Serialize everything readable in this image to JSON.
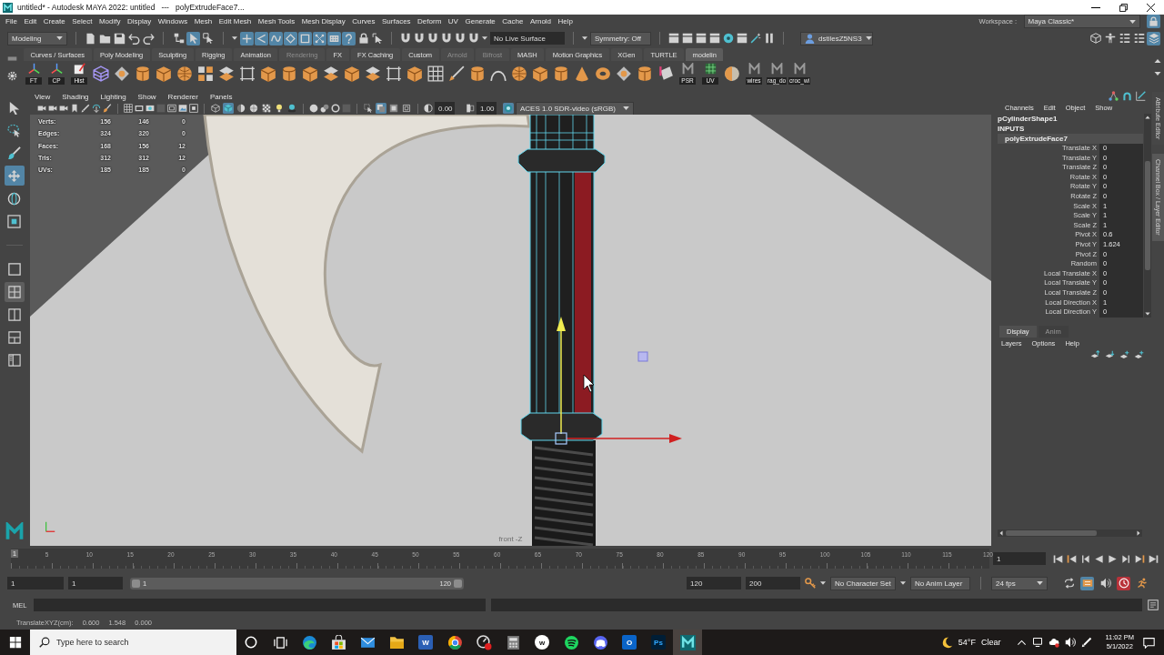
{
  "window": {
    "title": "untitled* - Autodesk MAYA 2022: untitled   ---   polyExtrudeFace7..."
  },
  "menu_bar": {
    "items": [
      "File",
      "Edit",
      "Create",
      "Select",
      "Modify",
      "Display",
      "Windows",
      "Mesh",
      "Edit Mesh",
      "Mesh Tools",
      "Mesh Display",
      "Curves",
      "Surfaces",
      "Deform",
      "UV",
      "Generate",
      "Cache",
      "Arnold",
      "Help"
    ],
    "workspace_label": "Workspace :",
    "workspace": "Maya Classic*",
    "workspace_lock": {
      "on": true
    }
  },
  "status_line": {
    "mode": "Modeling",
    "select_modes": [
      {
        "on": false
      },
      {
        "on": true
      },
      {
        "on": false
      }
    ],
    "masks": [
      {
        "on": true
      },
      {
        "on": true
      },
      {
        "on": true
      },
      {
        "on": true
      },
      {
        "on": true
      },
      {
        "on": true
      },
      {
        "on": true
      },
      {
        "on": true
      }
    ],
    "live_surface": "No Live Surface",
    "symmetry": "Symmetry: Off",
    "user": "dstilesZ5NS3",
    "panel_toggles": [
      {
        "on": false
      },
      {
        "on": false
      },
      {
        "on": false
      },
      {
        "on": false
      },
      {
        "on": true
      }
    ]
  },
  "shelf": {
    "tabs": [
      {
        "label": "Curves / Surfaces",
        "selected": false,
        "disabled": false
      },
      {
        "label": "Poly Modeling",
        "selected": false,
        "disabled": false
      },
      {
        "label": "Sculpting",
        "selected": false,
        "disabled": false
      },
      {
        "label": "Rigging",
        "selected": false,
        "disabled": false
      },
      {
        "label": "Animation",
        "selected": false,
        "disabled": false
      },
      {
        "label": "Rendering",
        "selected": false,
        "disabled": true
      },
      {
        "label": "FX",
        "selected": false,
        "disabled": false
      },
      {
        "label": "FX Caching",
        "selected": false,
        "disabled": false
      },
      {
        "label": "Custom",
        "selected": false,
        "disabled": false
      },
      {
        "label": "Arnold",
        "selected": false,
        "disabled": true
      },
      {
        "label": "Bifrost",
        "selected": false,
        "disabled": true
      },
      {
        "label": "MASH",
        "selected": false,
        "disabled": false
      },
      {
        "label": "Motion Graphics",
        "selected": false,
        "disabled": false
      },
      {
        "label": "XGen",
        "selected": false,
        "disabled": false
      },
      {
        "label": "TURTLE",
        "selected": false,
        "disabled": false
      },
      {
        "label": "modelin",
        "selected": true,
        "disabled": false
      }
    ],
    "history_buttons": [
      {
        "label": "FT"
      },
      {
        "label": "CP"
      },
      {
        "label": "Hist"
      }
    ],
    "tool_buttons": [
      {
        "label": "PSR"
      },
      {
        "label": "UV"
      }
    ],
    "script_buttons": [
      {
        "label": "wires"
      },
      {
        "label": "rag_do"
      },
      {
        "label": "croc_wi"
      }
    ]
  },
  "toolbox": {
    "tools": [
      {
        "selected": false
      },
      {
        "selected": false
      },
      {
        "selected": false
      },
      {
        "selected": true
      },
      {
        "selected": false
      },
      {
        "selected": false
      }
    ],
    "layouts": [
      {
        "selected": false
      },
      {
        "selected": true
      },
      {
        "selected": false
      },
      {
        "selected": false
      },
      {
        "selected": false
      }
    ]
  },
  "viewport_panel": {
    "menu": [
      "View",
      "Shading",
      "Lighting",
      "Show",
      "Renderer",
      "Panels"
    ],
    "shading_buttons": [
      {
        "on": false
      },
      {
        "on": true
      },
      {
        "on": false
      },
      {
        "on": false
      },
      {
        "on": false
      },
      {
        "on": false
      },
      {
        "on": false
      }
    ],
    "display_buttons": [
      {
        "on": false
      },
      {
        "on": true
      },
      {
        "on": false
      },
      {
        "on": false
      }
    ],
    "exposure": "0.00",
    "gamma": "1.00",
    "color_management": {
      "on": true
    },
    "color_space": "ACES 1.0 SDR-video (sRGB)",
    "hud": [
      {
        "label": "Verts:",
        "values": [
          "156",
          "146",
          "0"
        ]
      },
      {
        "label": "Edges:",
        "values": [
          "324",
          "320",
          "0"
        ]
      },
      {
        "label": "Faces:",
        "values": [
          "168",
          "156",
          "12"
        ]
      },
      {
        "label": "Tris:",
        "values": [
          "312",
          "312",
          "12"
        ]
      },
      {
        "label": "UVs:",
        "values": [
          "185",
          "185",
          "0"
        ]
      }
    ],
    "camera": "front -Z"
  },
  "channel_box": {
    "menu": [
      "Channels",
      "Edit",
      "Object",
      "Show"
    ],
    "object": "pCylinderShape1",
    "section": "INPUTS",
    "node": "polyExtrudeFace7",
    "attributes": [
      {
        "name": "Translate X",
        "value": "0"
      },
      {
        "name": "Translate Y",
        "value": "0"
      },
      {
        "name": "Translate Z",
        "value": "0"
      },
      {
        "name": "Rotate X",
        "value": "0"
      },
      {
        "name": "Rotate Y",
        "value": "0"
      },
      {
        "name": "Rotate Z",
        "value": "0"
      },
      {
        "name": "Scale X",
        "value": "1"
      },
      {
        "name": "Scale Y",
        "value": "1"
      },
      {
        "name": "Scale Z",
        "value": "1"
      },
      {
        "name": "Pivot X",
        "value": "0.6"
      },
      {
        "name": "Pivot Y",
        "value": "1.624"
      },
      {
        "name": "Pivot Z",
        "value": "0"
      },
      {
        "name": "Random",
        "value": "0"
      },
      {
        "name": "Local Translate X",
        "value": "0"
      },
      {
        "name": "Local Translate Y",
        "value": "0"
      },
      {
        "name": "Local Translate Z",
        "value": "0"
      },
      {
        "name": "Local Direction X",
        "value": "1"
      },
      {
        "name": "Local Direction Y",
        "value": "0"
      }
    ]
  },
  "side_tabs": [
    {
      "label": "Attribute Editor",
      "selected": false
    },
    {
      "label": "Channel Box / Layer Editor",
      "selected": true
    }
  ],
  "layer_editor": {
    "tabs": [
      {
        "label": "Display",
        "selected": true
      },
      {
        "label": "Anim",
        "selected": false
      }
    ],
    "menu": [
      "Layers",
      "Options",
      "Help"
    ]
  },
  "time_slider": {
    "current_frame_marker": "1",
    "ticks": [
      "5",
      "10",
      "15",
      "20",
      "25",
      "30",
      "35",
      "40",
      "45",
      "50",
      "55",
      "60",
      "65",
      "70",
      "75",
      "80",
      "85",
      "90",
      "95",
      "100",
      "105",
      "110",
      "115",
      "120"
    ],
    "current_frame": "1"
  },
  "range_slider": {
    "start": "1",
    "playback_start": "1",
    "handle_start": "1",
    "handle_end": "120",
    "playback_end": "120",
    "end": "200",
    "character_set": "No Character Set",
    "anim_layer": "No Anim Layer",
    "fps": "24 fps",
    "buttons": [
      {
        "on": false
      },
      {
        "on": true
      },
      {
        "on": false
      },
      {
        "on": true
      },
      {
        "on": false
      }
    ]
  },
  "command_line": {
    "language": "MEL"
  },
  "help_line": {
    "label": "TranslateXYZ(cm):",
    "values": [
      "0.600",
      "1.548",
      "0.000"
    ]
  },
  "taskbar": {
    "search": {
      "placeholder": "Type here to search"
    },
    "apps": [
      {
        "kind": "edge",
        "selected": false
      },
      {
        "kind": "store",
        "selected": false
      },
      {
        "kind": "mail",
        "selected": false
      },
      {
        "kind": "explorer",
        "selected": false
      },
      {
        "kind": "word",
        "glyph": "W",
        "selected": false
      },
      {
        "kind": "chrome",
        "selected": false
      },
      {
        "kind": "capture",
        "selected": false
      },
      {
        "kind": "calculator",
        "selected": false
      },
      {
        "kind": "writer",
        "glyph": "w",
        "selected": false
      },
      {
        "kind": "spotify",
        "selected": false
      },
      {
        "kind": "discord",
        "selected": false
      },
      {
        "kind": "outlook",
        "glyph": "O",
        "selected": false
      },
      {
        "kind": "photoshop",
        "glyph": "Ps",
        "selected": false
      },
      {
        "kind": "maya",
        "selected": true
      }
    ],
    "weather": {
      "temperature": "54°F",
      "condition": "Clear"
    },
    "time": "11:02 PM",
    "date": "5/1/2022"
  }
}
